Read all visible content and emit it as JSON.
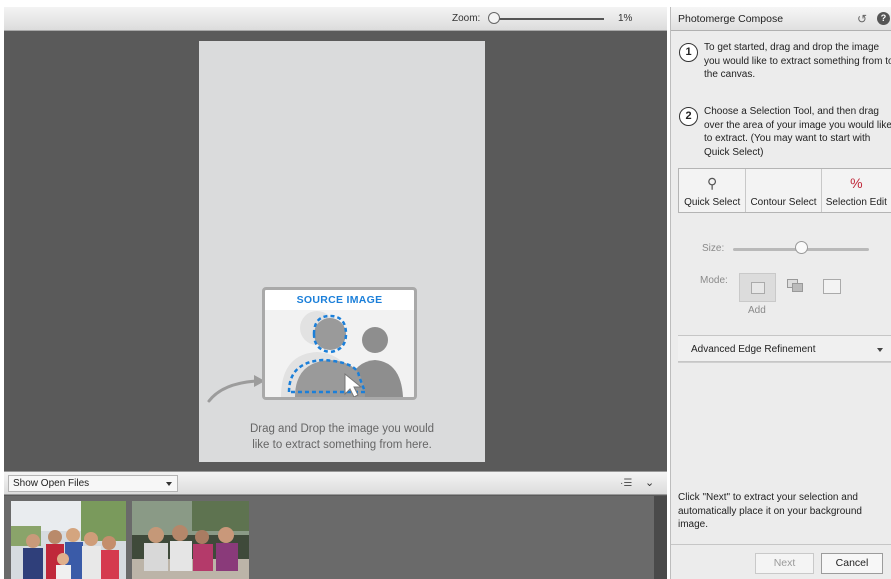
{
  "zoom": {
    "label": "Zoom:",
    "value": "1%",
    "level_fraction": 0.0
  },
  "canvas": {
    "source_card_title": "SOURCE IMAGE",
    "drop_text_line1": "Drag and Drop the image you would",
    "drop_text_line2": "like to extract something from here."
  },
  "files_bar": {
    "select_value": "Show Open Files"
  },
  "panel": {
    "title": "Photomerge Compose",
    "steps": [
      {
        "number": "1",
        "text": "To get started, drag and drop the image you would like to extract something from to the canvas."
      },
      {
        "number": "2",
        "text": "Choose a Selection Tool, and then drag over the area of your image you would like to extract. (You may want to start with Quick Select)"
      }
    ],
    "tools": [
      {
        "label": "Quick Select",
        "icon": "quick-select-icon"
      },
      {
        "label": "Contour Select",
        "icon": "contour-select-icon"
      },
      {
        "label": "Selection Edit",
        "icon": "selection-edit-icon"
      }
    ],
    "size_label": "Size:",
    "size_level": 0.5,
    "mode_label": "Mode:",
    "mode_add_label": "Add",
    "advanced_edge_label": "Advanced Edge Refinement",
    "next_hint": "Click \"Next\" to extract your selection and automatically place it on your background image.",
    "next_button": "Next",
    "cancel_button": "Cancel"
  },
  "colors": {
    "source_title_blue": "#1b7fd9",
    "work_area_gray": "#5a5a5a"
  }
}
